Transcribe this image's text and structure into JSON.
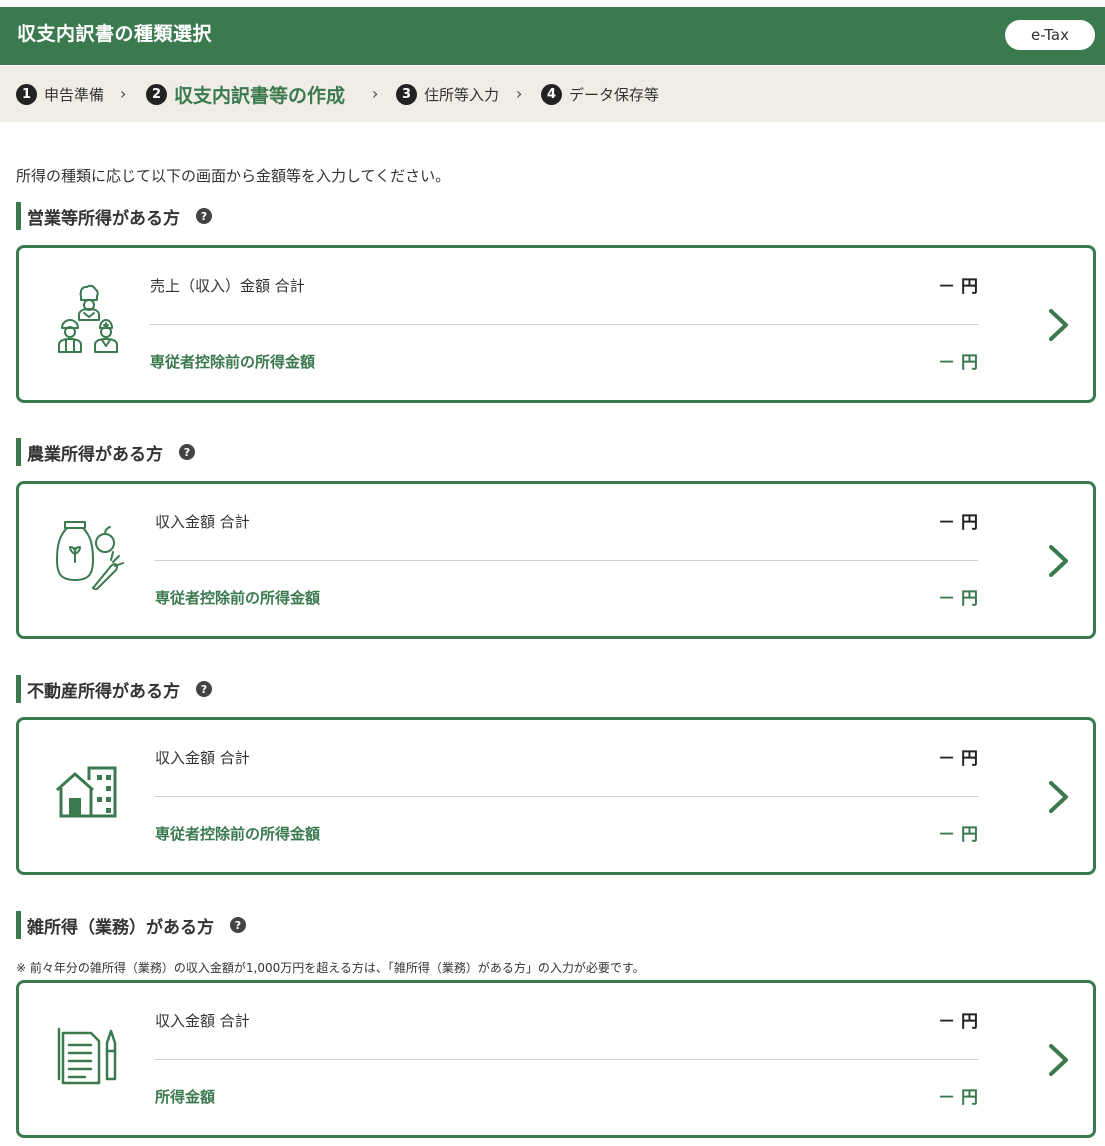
{
  "header": {
    "title": "収支内訳書の種類選択",
    "etax_label": "e-Tax"
  },
  "steps": [
    {
      "num": "1",
      "label": "申告準備"
    },
    {
      "num": "2",
      "label": "収支内訳書等の作成"
    },
    {
      "num": "3",
      "label": "住所等入力"
    },
    {
      "num": "4",
      "label": "データ保存等"
    }
  ],
  "step_separator": "›",
  "intro": "所得の種類に応じて以下の画面から金額等を入力してください。",
  "help_glyph": "?",
  "sections": [
    {
      "title": "営業等所得がある方",
      "icon": "workers-icon",
      "label1": "売上（収入）金額  合計",
      "value1": "－ 円",
      "label2": "専従者控除前の所得金額",
      "value2": "－ 円"
    },
    {
      "title": "農業所得がある方",
      "icon": "agriculture-icon",
      "label1": "収入金額  合計",
      "value1": "－ 円",
      "label2": "専従者控除前の所得金額",
      "value2": "－ 円"
    },
    {
      "title": "不動産所得がある方",
      "icon": "real-estate-icon",
      "label1": "収入金額  合計",
      "value1": "－ 円",
      "label2": "専従者控除前の所得金額",
      "value2": "－ 円"
    },
    {
      "title": "雑所得（業務）がある方",
      "icon": "documents-icon",
      "label1": "収入金額  合計",
      "value1": "－ 円",
      "label2": "所得金額",
      "value2": "－ 円"
    }
  ],
  "misc_note": "※ 前々年分の雑所得（業務）の収入金額が1,000万円を超える方は、「雑所得（業務）がある方」の入力が必要です。",
  "colors": {
    "brand_green": "#3b7a4f",
    "steps_bg": "#efede5"
  }
}
